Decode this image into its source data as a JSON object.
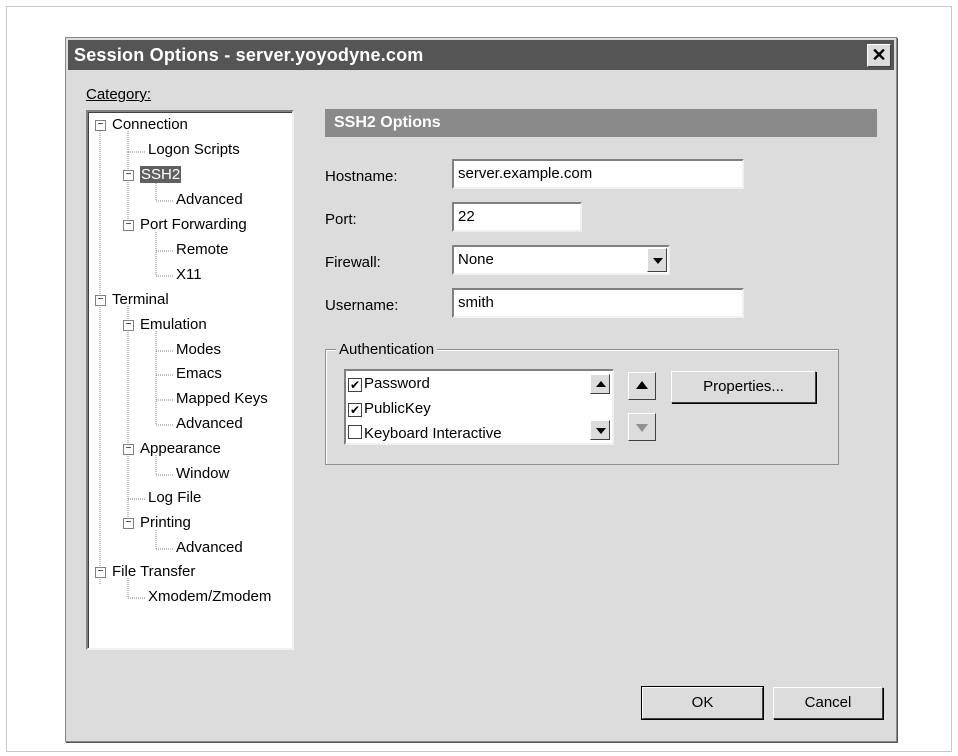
{
  "dialog": {
    "title": "Session Options - server.yoyodyne.com",
    "close_glyph": "✕"
  },
  "category": {
    "label": "Category:",
    "tree": [
      {
        "label": "Connection",
        "expander": "−"
      },
      {
        "label": "Logon Scripts"
      },
      {
        "label": "SSH2",
        "expander": "−",
        "selected": true
      },
      {
        "label": "Advanced"
      },
      {
        "label": "Port Forwarding",
        "expander": "−"
      },
      {
        "label": "Remote"
      },
      {
        "label": "X11"
      },
      {
        "label": "Terminal",
        "expander": "−"
      },
      {
        "label": "Emulation",
        "expander": "−"
      },
      {
        "label": "Modes"
      },
      {
        "label": "Emacs"
      },
      {
        "label": "Mapped Keys"
      },
      {
        "label": "Advanced"
      },
      {
        "label": "Appearance",
        "expander": "−"
      },
      {
        "label": "Window"
      },
      {
        "label": "Log File"
      },
      {
        "label": "Printing",
        "expander": "−"
      },
      {
        "label": "Advanced"
      },
      {
        "label": "File Transfer",
        "expander": "−"
      },
      {
        "label": "Xmodem/Zmodem"
      }
    ]
  },
  "ssh2": {
    "header": "SSH2 Options",
    "hostname": {
      "label": "Hostname:",
      "value": "server.example.com"
    },
    "port": {
      "label": "Port:",
      "value": "22"
    },
    "firewall": {
      "label": "Firewall:",
      "value": "None"
    },
    "username": {
      "label": "Username:",
      "value": "smith"
    }
  },
  "authentication": {
    "title": "Authentication",
    "methods": [
      {
        "label": "Password",
        "checked": true
      },
      {
        "label": "PublicKey",
        "checked": true
      },
      {
        "label": "Keyboard Interactive",
        "checked": false
      }
    ],
    "properties_label": "Properties..."
  },
  "footer": {
    "ok_label": "OK",
    "cancel_label": "Cancel"
  },
  "colors": {
    "dialog_bg": "#dcdcdc",
    "titlebar": "#555555",
    "section_header": "#8a8a8a",
    "selection": "#606060"
  }
}
